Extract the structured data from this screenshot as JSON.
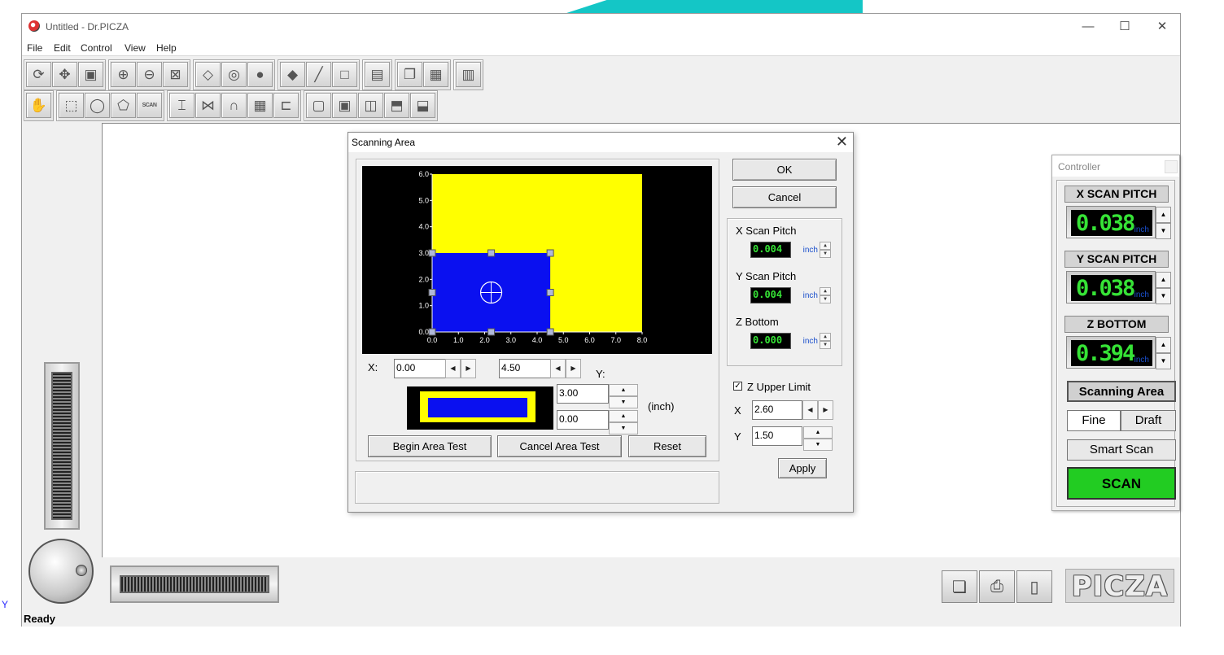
{
  "window": {
    "title": "Untitled - Dr.PICZA",
    "controls": {
      "minimize": "—",
      "maximize": "☐",
      "close": "✕"
    }
  },
  "menu": [
    "File",
    "Edit",
    "Control",
    "View",
    "Help"
  ],
  "toolbar": {
    "row1_icons": [
      "rotate-icon",
      "move-icon",
      "cube-icon",
      "zoom-in-icon",
      "zoom-out-icon",
      "zoom-fit-icon",
      "wireframe-icon",
      "shaded-icon",
      "sphere-icon",
      "paint-bucket-icon",
      "brush-icon",
      "square-icon",
      "transform-icon",
      "copy-icon",
      "mesh-icon",
      "remote-icon"
    ],
    "row2_icons": [
      "hand-icon",
      "select-icon",
      "lasso-icon",
      "polygon-select-icon",
      "scan-area-icon",
      "section-icon",
      "mirror-icon",
      "arch-icon",
      "grid-select-icon",
      "measure-icon",
      "box-view-icon",
      "box-front-icon",
      "box-side-icon",
      "box-top-icon",
      "box-iso-icon"
    ],
    "scan_label": "SCAN"
  },
  "status": {
    "text": "Ready"
  },
  "axis_label": "Y",
  "logo": "PICZA",
  "dialog": {
    "title": "Scanning Area",
    "close": "✕",
    "ok": "OK",
    "cancel": "Cancel",
    "x_label": "X:",
    "y_label": "Y:",
    "x_start": "0.00",
    "x_end": "4.50",
    "y_top": "3.00",
    "y_bottom": "0.00",
    "unit": "(inch)",
    "begin_test": "Begin Area Test",
    "cancel_test": "Cancel Area Test",
    "reset": "Reset",
    "x_scan_pitch_label": "X Scan Pitch",
    "x_scan_pitch": "0.004",
    "y_scan_pitch_label": "Y Scan Pitch",
    "y_scan_pitch": "0.004",
    "z_bottom_label": "Z Bottom",
    "z_bottom": "0.000",
    "pitch_unit": "inch",
    "z_upper_limit_label": "Z Upper Limit",
    "z_upper_limit_checked": true,
    "zx_label": "X",
    "zx_value": "2.60",
    "zy_label": "Y",
    "zy_value": "1.50",
    "apply": "Apply",
    "status_text": ""
  },
  "chart_data": {
    "type": "area",
    "x_ticks": [
      "0.0",
      "1.0",
      "2.0",
      "3.0",
      "4.0",
      "5.0",
      "6.0",
      "7.0",
      "8.0"
    ],
    "y_ticks": [
      "0.0",
      "1.0",
      "2.0",
      "3.0",
      "4.0",
      "5.0",
      "6.0"
    ],
    "xlim": [
      0,
      8
    ],
    "ylim": [
      0,
      6
    ],
    "bed": {
      "x": [
        0,
        8
      ],
      "y": [
        0,
        6
      ],
      "color": "#ffff00"
    },
    "scan_area": {
      "x": [
        0,
        4.5
      ],
      "y": [
        0,
        3
      ],
      "color": "#0a10f0"
    },
    "background": "#000000"
  },
  "controller": {
    "title": "Controller",
    "x_pitch_label": "X SCAN PITCH",
    "x_pitch": "0.038",
    "y_pitch_label": "Y SCAN PITCH",
    "y_pitch": "0.038",
    "z_bottom_label": "Z BOTTOM",
    "z_bottom": "0.394",
    "unit": "inch",
    "scanning_area": "Scanning Area",
    "fine": "Fine",
    "draft": "Draft",
    "smart_scan": "Smart Scan",
    "scan": "SCAN",
    "scan_color": "#22cc22"
  }
}
